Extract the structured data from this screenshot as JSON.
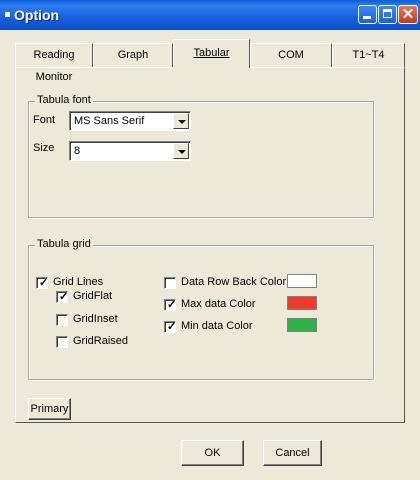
{
  "window": {
    "title": "Option"
  },
  "tabs": [
    {
      "label": "Reading Monitor",
      "active": false
    },
    {
      "label": "Graph",
      "active": false
    },
    {
      "label": "Tabular",
      "active": true
    },
    {
      "label": "COM",
      "active": false
    },
    {
      "label": "T1~T4",
      "active": false
    }
  ],
  "tabular_font": {
    "group_title": "Tabula font",
    "font_label": "Font",
    "font_value": "MS Sans Serif",
    "size_label": "Size",
    "size_value": "8"
  },
  "tabular_grid": {
    "group_title": "Tabula grid",
    "grid_lines": {
      "label": "Grid Lines",
      "checked": true
    },
    "grid_flat": {
      "label": "GridFlat",
      "checked": true
    },
    "grid_inset": {
      "label": "GridInset",
      "checked": false
    },
    "grid_raised": {
      "label": "GridRaised",
      "checked": false
    },
    "data_row_back": {
      "label": "Data Row Back Color",
      "checked": false,
      "color": "#ffffff"
    },
    "max_data": {
      "label": "Max  data Color",
      "checked": true,
      "color": "#ee3a2c"
    },
    "min_data": {
      "label": "Min data Color",
      "checked": true,
      "color": "#2fb24a"
    }
  },
  "buttons": {
    "primary": "Primary",
    "ok": "OK",
    "cancel": "Cancel"
  },
  "icons": {
    "window_icon": "app-icon",
    "minimize": "minimize-icon",
    "maximize": "maximize-icon",
    "close": "close-icon",
    "dropdown": "chevron-down-icon"
  },
  "colors": {
    "titlebar": "#1a63df",
    "face": "#ece9d8"
  }
}
